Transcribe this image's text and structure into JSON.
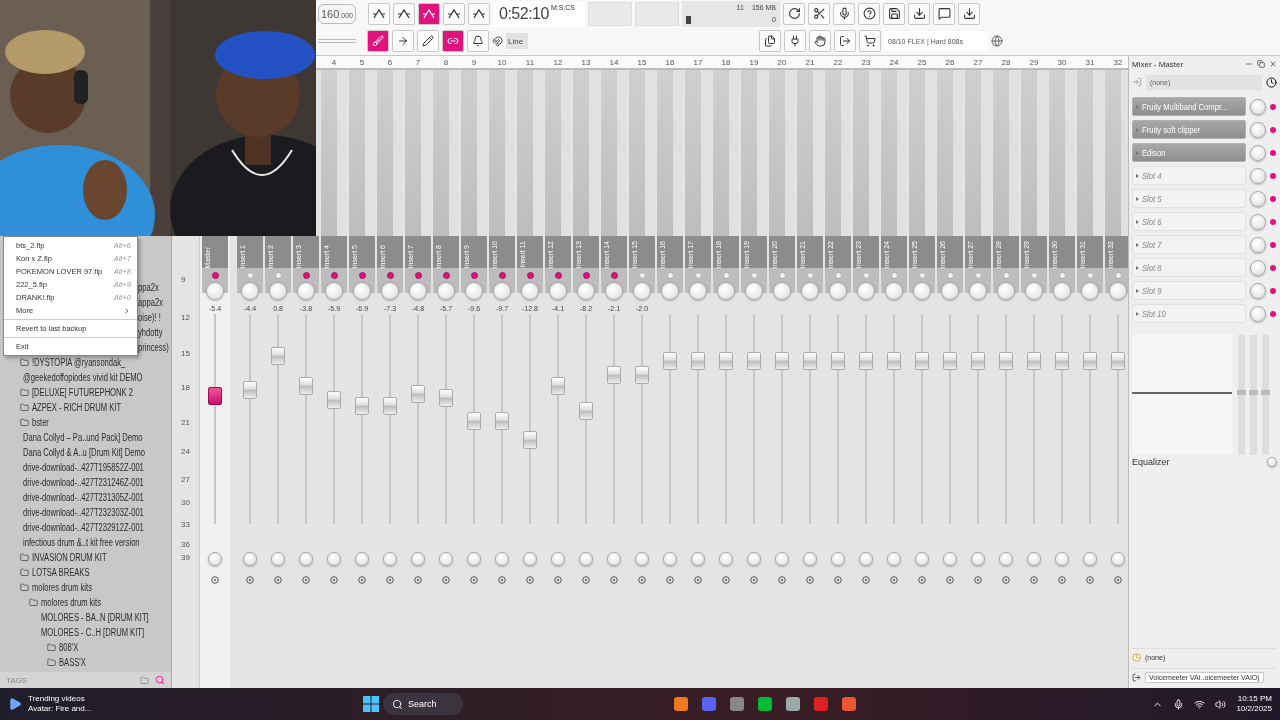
{
  "toolbar": {
    "tempo": "160",
    "tempo_fraction": ".000",
    "time": "0:52:10",
    "time_format": "M:S:CS",
    "cpu": "11",
    "memory": "156 MB",
    "polyphony": "0",
    "snap": "Line",
    "hint": "08/10 FLEX | Hard 808s",
    "mode_buttons": [
      {
        "selected": false
      },
      {
        "selected": false
      },
      {
        "selected": true
      },
      {
        "selected": false
      },
      {
        "selected": false
      }
    ],
    "tool_buttons": [
      {
        "selected": true
      },
      {
        "selected": false
      },
      {
        "selected": false
      },
      {
        "selected": true
      },
      {
        "selected": false
      }
    ]
  },
  "file_menu": {
    "items": [
      {
        "kind": "recent",
        "label": "bts_2.flp",
        "shortcut": "Alt+6"
      },
      {
        "kind": "recent",
        "label": "Kon x Z.flp",
        "shortcut": "Alt+7"
      },
      {
        "kind": "recent",
        "label": "POKEMON LOVER 97.flp",
        "shortcut": "Alt+8"
      },
      {
        "kind": "recent",
        "label": "222_5.flp",
        "shortcut": "Alt+9"
      },
      {
        "kind": "recent",
        "label": "DRANK!.flp",
        "shortcut": "Alt+0"
      },
      {
        "kind": "submenu",
        "label": "More"
      },
      {
        "kind": "action",
        "label": "Revert to last backup"
      },
      {
        "kind": "action",
        "label": "Exit"
      }
    ]
  },
  "browser": {
    "tags_label": "TAGS",
    "items": [
      {
        "label": "ppa2x",
        "partial": true
      },
      {
        "label": "appa2x",
        "partial": true
      },
      {
        "label": "oise)!  !",
        "partial": true
      },
      {
        "label": "yhdotty",
        "partial": true
      },
      {
        "label": "princess)",
        "partial": true
      },
      {
        "label": "!DYSTOPIA @ryansondak_"
      },
      {
        "label": "@geekedoffopiodes vivid kit DEMO"
      },
      {
        "label": "[DELUXE] FUTUREPHONK 2"
      },
      {
        "label": "AZPEX - RICH DRUM KIT"
      },
      {
        "label": "bster"
      },
      {
        "label": "Dana Collyd – Pa..und Pack] Demo"
      },
      {
        "label": "Dana Collyd & A..u [Drum Kit] Demo"
      },
      {
        "label": "drive-download-..427T195852Z-001"
      },
      {
        "label": "drive-download-..427T231246Z-001"
      },
      {
        "label": "drive-download-..427T231305Z-001"
      },
      {
        "label": "drive-download-..427T232303Z-001"
      },
      {
        "label": "drive-download-..427T232912Z-001"
      },
      {
        "label": "infectious drum &..t kit free version"
      },
      {
        "label": "INVASION DRUM KIT"
      },
      {
        "label": "LOTSA BREAKS"
      },
      {
        "label": "molores drum kits",
        "children": [
          {
            "label": "molores drum kits",
            "children": [
              {
                "label": "MOLORES - BA..N [DRUM KIT]"
              },
              {
                "label": "MOLORES - C..H [DRUM KIT]",
                "children": [
                  {
                    "label": "808'X"
                  },
                  {
                    "label": "BASS'X"
                  }
                ]
              }
            ]
          }
        ]
      }
    ]
  },
  "mixer": {
    "scale": [
      "9",
      "12",
      "15",
      "18",
      "21",
      "24",
      "27",
      "30",
      "33",
      "36",
      "39"
    ],
    "master": {
      "name": "Master",
      "volume": "-5.4",
      "level": 0.62,
      "active": true
    },
    "inserts": [
      {
        "name": "Insert 1",
        "volume": "-4.4",
        "level": 0.65,
        "active": false
      },
      {
        "name": "Insert 2",
        "volume": "0.8",
        "level": 0.83,
        "active": false
      },
      {
        "name": "Insert 3",
        "volume": "-3.8",
        "level": 0.67,
        "active": true
      },
      {
        "number": "4",
        "name": "Insert 4",
        "volume": "-5.9",
        "level": 0.6,
        "active": true
      },
      {
        "number": "5",
        "name": "Insert 5",
        "volume": "-6.9",
        "level": 0.57,
        "active": true
      },
      {
        "number": "6",
        "name": "Insert 6",
        "volume": "-7.3",
        "level": 0.57,
        "active": true
      },
      {
        "number": "7",
        "name": "Insert 7",
        "volume": "-4.8",
        "level": 0.63,
        "active": true
      },
      {
        "number": "8",
        "name": "Insert 8",
        "volume": "-5.7",
        "level": 0.61,
        "active": true
      },
      {
        "number": "9",
        "name": "Insert 9",
        "volume": "-9.6",
        "level": 0.49,
        "active": true
      },
      {
        "number": "10",
        "name": "Insert 10",
        "volume": "-9.7",
        "level": 0.49,
        "active": true
      },
      {
        "number": "11",
        "name": "Insert 11",
        "volume": "-12.8",
        "level": 0.39,
        "active": true
      },
      {
        "number": "12",
        "name": "Insert 12",
        "volume": "-4.1",
        "level": 0.67,
        "active": true
      },
      {
        "number": "13",
        "name": "Insert 13",
        "volume": "-8.2",
        "level": 0.54,
        "active": true
      },
      {
        "number": "14",
        "name": "Insert 14",
        "volume": "-2.1",
        "level": 0.73,
        "active": true
      },
      {
        "number": "15",
        "name": "Insert 15",
        "volume": "-2.0",
        "level": 0.73,
        "active": false
      },
      {
        "number": "16",
        "name": "Insert 16",
        "level": 0.8,
        "active": false
      },
      {
        "number": "17",
        "name": "Insert 17",
        "level": 0.8,
        "active": false
      },
      {
        "number": "18",
        "name": "Insert 18",
        "level": 0.8,
        "active": false
      },
      {
        "number": "19",
        "name": "Insert 19",
        "level": 0.8,
        "active": false
      },
      {
        "number": "20",
        "name": "Insert 20",
        "level": 0.8,
        "active": false
      },
      {
        "number": "21",
        "name": "Insert 21",
        "level": 0.8,
        "active": false
      },
      {
        "number": "22",
        "name": "Insert 22",
        "level": 0.8,
        "active": false
      },
      {
        "number": "23",
        "name": "Insert 23",
        "level": 0.8,
        "active": false
      },
      {
        "number": "24",
        "name": "Insert 24",
        "level": 0.8,
        "active": false
      },
      {
        "number": "25",
        "name": "Insert 25",
        "level": 0.8,
        "active": false
      },
      {
        "number": "26",
        "name": "Insert 26",
        "level": 0.8,
        "active": false
      },
      {
        "number": "27",
        "name": "Insert 27",
        "level": 0.8,
        "active": false
      },
      {
        "number": "28",
        "name": "Insert 28",
        "level": 0.8,
        "active": false
      },
      {
        "number": "29",
        "name": "Insert 29",
        "level": 0.8,
        "active": false
      },
      {
        "number": "30",
        "name": "Insert 30",
        "level": 0.8,
        "active": false
      },
      {
        "number": "31",
        "name": "Insert 31",
        "level": 0.8,
        "active": false
      },
      {
        "number": "32",
        "name": "Insert 32",
        "level": 0.8,
        "active": false
      }
    ]
  },
  "channel_panel": {
    "title": "Mixer - Master",
    "input": "(none)",
    "slots": [
      {
        "kind": "plugin",
        "label": "Fruity Multiband Compr...",
        "on": true
      },
      {
        "kind": "plugin",
        "label": "Fruity soft clipper",
        "on": true
      },
      {
        "kind": "plugin",
        "label": "Edison",
        "on": true
      },
      {
        "kind": "empty",
        "label": "Slot 4",
        "on": true
      },
      {
        "kind": "empty",
        "label": "Slot 5",
        "on": true
      },
      {
        "kind": "empty",
        "label": "Slot 6",
        "on": true
      },
      {
        "kind": "empty",
        "label": "Slot 7",
        "on": true
      },
      {
        "kind": "empty",
        "label": "Slot 8",
        "on": true
      },
      {
        "kind": "empty",
        "label": "Slot 9",
        "on": true
      },
      {
        "kind": "empty",
        "label": "Slot 10",
        "on": true
      }
    ],
    "eq_label": "Equalizer",
    "output_none": "(none)",
    "output": "Voicemeeter VAI..oicemeeter VAIO)"
  },
  "taskbar": {
    "widget_title": "Trending videos",
    "widget_text": "Avatar: Fire and...",
    "search": "Search",
    "time": "10:15 PM",
    "date": "10/2/2025"
  }
}
